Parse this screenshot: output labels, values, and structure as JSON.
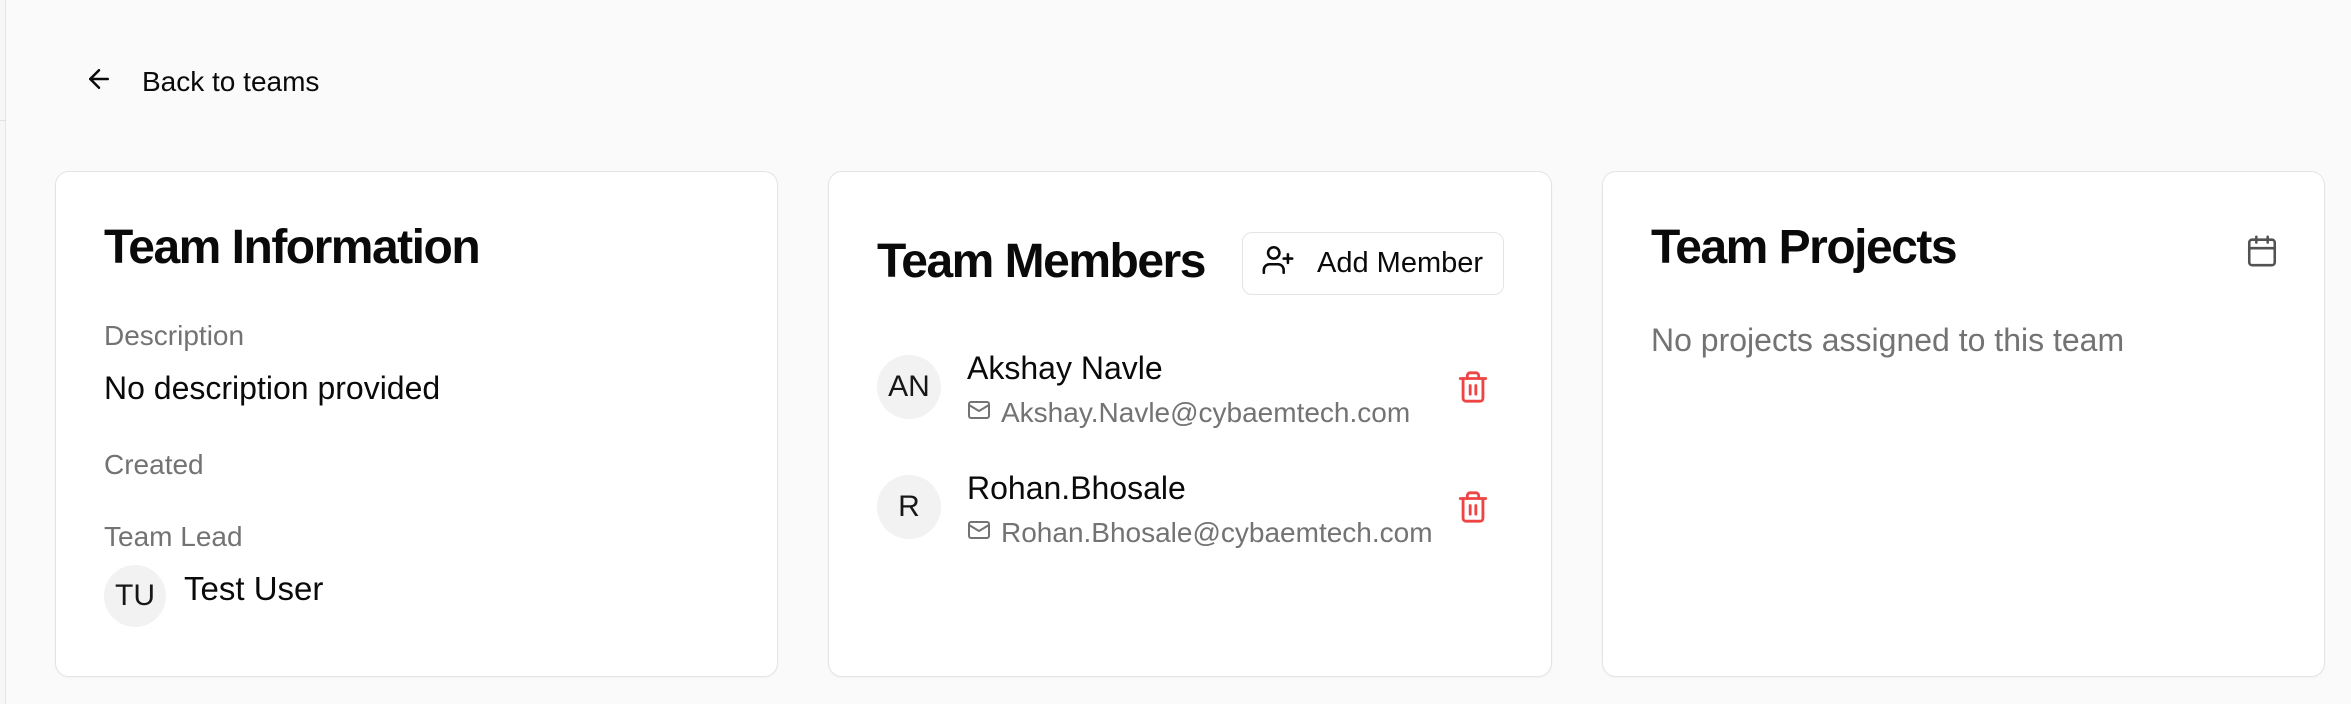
{
  "nav": {
    "back_label": "Back to teams"
  },
  "team_info": {
    "title": "Team Information",
    "description_label": "Description",
    "description_value": "No description provided",
    "created_label": "Created",
    "lead_label": "Team Lead",
    "lead_initials": "TU",
    "lead_name": "Test User"
  },
  "members": {
    "title": "Team Members",
    "add_label": "Add Member",
    "items": [
      {
        "initials": "AN",
        "name": "Akshay Navle",
        "email": "Akshay.Navle@cybaemtech.com"
      },
      {
        "initials": "R",
        "name": "Rohan.Bhosale",
        "email": "Rohan.Bhosale@cybaemtech.com"
      }
    ]
  },
  "projects": {
    "title": "Team Projects",
    "empty_text": "No projects assigned to this team"
  },
  "colors": {
    "background": "#fafafa",
    "card": "#ffffff",
    "border": "#e4e4e7",
    "muted_text": "#737373",
    "danger": "#ef4444"
  },
  "icons": [
    "arrow-left-icon",
    "user-plus-icon",
    "mail-icon",
    "trash-icon",
    "calendar-icon"
  ]
}
